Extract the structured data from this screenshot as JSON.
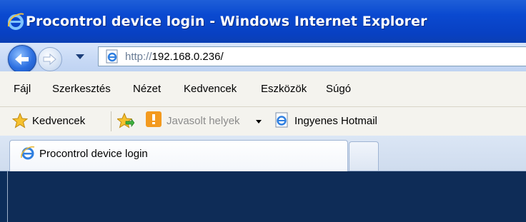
{
  "window": {
    "title": "Procontrol device login - Windows Internet Explorer"
  },
  "address_bar": {
    "url_scheme": "http://",
    "url_host": "192.168.0.236/"
  },
  "menu": {
    "items": [
      {
        "label": "Fájl"
      },
      {
        "label": "Szerkesztés"
      },
      {
        "label": "Nézet"
      },
      {
        "label": "Kedvencek"
      },
      {
        "label": "Eszközök"
      },
      {
        "label": "Súgó"
      }
    ]
  },
  "favorites_bar": {
    "favorites_label": "Kedvencek",
    "suggested_sites_label": "Javasolt helyek",
    "hotmail_label": "Ingyenes Hotmail"
  },
  "tabs": [
    {
      "label": "Procontrol device login",
      "active": true
    }
  ],
  "colors": {
    "titlebar": "#0a49d0",
    "content_background": "#0e2c57"
  },
  "icons": [
    "ie-logo-icon",
    "back-arrow-icon",
    "forward-arrow-icon",
    "dropdown-icon",
    "page-icon",
    "star-icon",
    "add-favorite-icon",
    "suggested-sites-icon",
    "ie-page-icon",
    "tab-ie-icon"
  ]
}
